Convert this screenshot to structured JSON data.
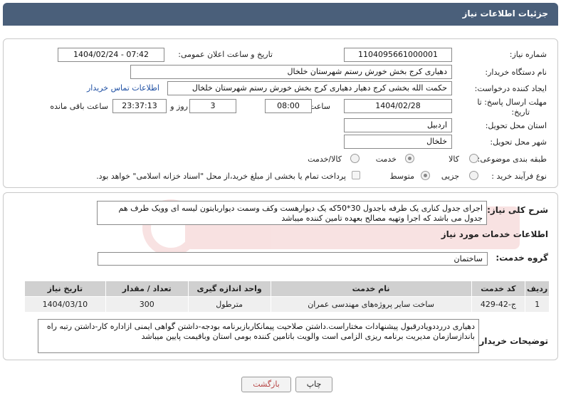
{
  "header": {
    "title": "جزئیات اطلاعات نیاز"
  },
  "fields": {
    "need_number_label": "شماره نیاز:",
    "need_number": "1104095661000001",
    "announce_label": "تاریخ و ساعت اعلان عمومی:",
    "announce_value": "1404/02/24 - 07:42",
    "buyer_org_label": "نام دستگاه خریدار:",
    "buyer_org": "دهیاری کرج بخش خورش رستم شهرستان خلخال",
    "creator_label": "ایجاد کننده درخواست:",
    "creator": "حکمت الله بخشی کرج دهیار دهیاری کرج بخش خورش رستم شهرستان خلخال",
    "contact_link": "اطلاعات تماس خریدار",
    "deadline_label_1": "مهلت ارسال پاسخ: تا",
    "deadline_label_2": "تاریخ:",
    "deadline_date": "1404/02/28",
    "time_label": "ساعت",
    "deadline_time": "08:00",
    "days": "3",
    "days_label": "روز و",
    "remaining_time": "23:37:13",
    "remaining_label": "ساعت باقی مانده",
    "province_label": "استان محل تحویل:",
    "province": "اردبیل",
    "city_label": "شهر محل تحویل:",
    "city": "خلخال",
    "category_label": "طبقه بندی موضوعی:",
    "category_options": [
      "کالا",
      "خدمت",
      "کالا/خدمت"
    ],
    "process_label": "نوع فرآیند خرید :",
    "process_options": [
      "جزیی",
      "متوسط"
    ],
    "payment_note": "پرداخت تمام یا بخشی از مبلغ خرید،از محل \"اسناد خزانه اسلامی\" خواهد بود."
  },
  "description": {
    "label": "شرح کلی نیاز:",
    "text": "اجرای جدول کناری یک طرفه باجدول 30*50که یک دیوارهست وکف وسمت دیواربابتون لیسه ای وویک طرف هم جدول می باشد که اجرا وتهیه مصالح بعهده تامین کننده میباشد"
  },
  "services": {
    "section_title": "اطلاعات خدمات مورد نیاز",
    "group_label": "گروه خدمت:",
    "group_value": "ساختمان",
    "columns": [
      "ردیف",
      "کد خدمت",
      "نام خدمت",
      "واحد اندازه گیری",
      "تعداد / مقدار",
      "تاریخ نیاز"
    ],
    "rows": [
      [
        "1",
        "ج-42-429",
        "ساخت سایر پروژه‌های مهندسی عمران",
        "مترطول",
        "300",
        "1404/03/10"
      ]
    ]
  },
  "buyer_notes": {
    "label": "توضیحات خریدار:",
    "text": "دهیاری دررددویادرقبول پیشنهادات مختاراست.داشتن صلاحیت پیمانکاربازبرنامه بودجه-داشتن گواهی ایمنی ازاداره کار-داشتن رتبه راه باندازسازمان مدیریت برنامه ریزی الزامی است والویت باتامین کننده بومی استان وباقیمت پایین  میباشد"
  },
  "buttons": {
    "print": "چاپ",
    "back": "بازگشت"
  },
  "colors": {
    "header_bg": "#4a5f7a",
    "link": "#1e4fa3",
    "back_text": "#b54040"
  }
}
